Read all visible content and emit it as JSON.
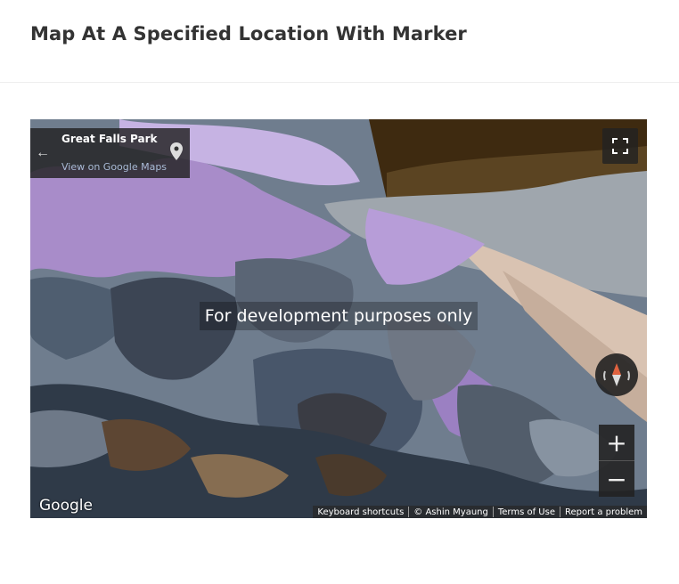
{
  "header": {
    "title": "Map At A Specified Location With Marker"
  },
  "map": {
    "info_card": {
      "place_name": "Great Falls Park",
      "link_label": "View on Google Maps",
      "back_glyph": "←"
    },
    "dev_banner": "For development purposes only",
    "zoom_in_label": "+",
    "zoom_out_label": "−",
    "logo_text": "Google",
    "attribution": {
      "keyboard": "Keyboard shortcuts",
      "copyright": "© Ashin Myaung",
      "terms": "Terms of Use",
      "report": "Report a problem"
    },
    "icons": {
      "back": "arrow-left-icon",
      "pin": "map-pin-icon",
      "fullscreen": "fullscreen-icon",
      "compass": "compass-icon"
    }
  }
}
